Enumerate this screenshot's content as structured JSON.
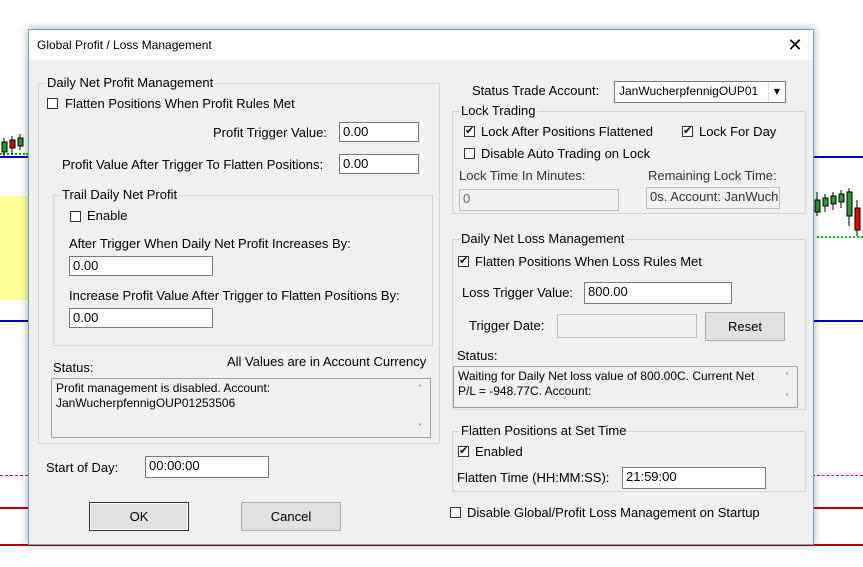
{
  "dialog": {
    "title": "Global Profit / Loss Management",
    "close_glyph": "✕"
  },
  "profit": {
    "legend": "Daily Net Profit Management",
    "flatten_label": "Flatten Positions When Profit Rules Met",
    "flatten_checked": false,
    "trigger_label": "Profit Trigger Value:",
    "trigger_value": "0.00",
    "after_label": "Profit Value After Trigger To Flatten Positions:",
    "after_value": "0.00",
    "trail": {
      "legend": "Trail Daily Net Profit",
      "enable_label": "Enable",
      "enable_checked": false,
      "increase_label": "After Trigger When Daily Net Profit Increases By:",
      "increase_value": "0.00",
      "incr_flatten_label": "Increase Profit Value After Trigger to Flatten Positions By:",
      "incr_flatten_value": "0.00"
    },
    "status_label": "Status:",
    "currency_note": "All Values are in Account Currency",
    "status_text": "Profit management is disabled. Account: JanWucherpfennigOUP01253506"
  },
  "start_of_day": {
    "label": "Start of Day:",
    "value": "00:00:00"
  },
  "buttons": {
    "ok": "OK",
    "cancel": "Cancel",
    "reset": "Reset"
  },
  "account": {
    "label": "Status Trade Account:",
    "value": "JanWucherpfennigOUP01"
  },
  "lock": {
    "legend": "Lock Trading",
    "lock_after_label": "Lock After Positions Flattened",
    "lock_after_checked": true,
    "lock_day_label": "Lock For Day",
    "lock_day_checked": true,
    "disable_auto_label": "Disable Auto Trading on Lock",
    "disable_auto_checked": false,
    "time_label": "Lock Time In Minutes:",
    "time_value": "0",
    "remaining_label": "Remaining Lock Time:",
    "remaining_value": "0s. Account: JanWuch"
  },
  "loss": {
    "legend": "Daily Net Loss Management",
    "flatten_label": "Flatten Positions When Loss Rules Met",
    "flatten_checked": true,
    "trigger_label": "Loss Trigger Value:",
    "trigger_value": "800.00",
    "date_label": "Trigger Date:",
    "date_value": "",
    "status_label": "Status:",
    "status_text": "Waiting for Daily Net loss value of 800.00C.  Current Net P/L = -948.77C.  Account:"
  },
  "flatten_time": {
    "legend": "Flatten Positions at Set Time",
    "enabled_label": "Enabled",
    "enabled_checked": true,
    "time_label": "Flatten Time (HH:MM:SS):",
    "time_value": "21:59:00"
  },
  "disable_global": {
    "label": "Disable Global/Profit Loss Management on Startup",
    "checked": false
  },
  "colors": {
    "blue_line": "#0000c8",
    "red_line": "#b40000",
    "green_dots": "#00c800",
    "magenta_dash": "#c800c8",
    "yellow_band": "#ffff99"
  }
}
